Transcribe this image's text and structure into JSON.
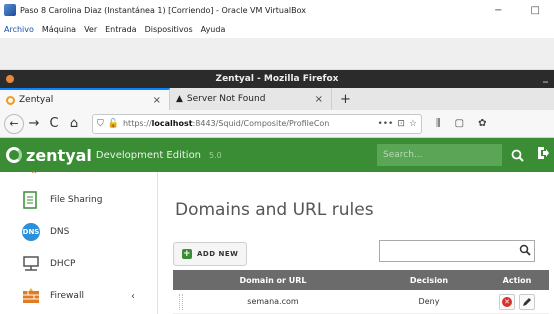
{
  "vbox": {
    "title": "Paso 8 Carolina Diaz (Instantánea 1) [Corriendo] - Oracle VM VirtualBox",
    "minimize": "−",
    "maximize": "□",
    "menu": [
      "Archivo",
      "Máquina",
      "Ver",
      "Entrada",
      "Dispositivos",
      "Ayuda"
    ]
  },
  "firefox": {
    "window_title": "Zentyal - Mozilla Firefox",
    "window_min": "_",
    "tabs": [
      {
        "label": "Zentyal",
        "close": "×"
      },
      {
        "label": "Server Not Found",
        "close": "×"
      }
    ],
    "new_tab": "+",
    "nav": {
      "back": "←",
      "forward": "→",
      "reload": "C",
      "home": "⌂"
    },
    "url": {
      "prefix": "https://",
      "host": "localhost",
      "rest": ":8443/Squid/Composite/ProfileCon",
      "more": "•••"
    }
  },
  "zentyal": {
    "logo": "zentyal",
    "edition": "Development Edition",
    "version": "5.0",
    "search_placeholder": "Search...",
    "search_icon": "search-icon",
    "logout_icon": "logout-icon",
    "colors": {
      "header": "#3a8d35",
      "danger": "#d9312b"
    }
  },
  "sidebar": {
    "items": [
      {
        "label": "File Sharing",
        "icon": "file-sharing-icon"
      },
      {
        "label": "DNS",
        "icon": "dns-icon",
        "icon_text": "DNS"
      },
      {
        "label": "DHCP",
        "icon": "dhcp-icon"
      },
      {
        "label": "Firewall",
        "icon": "firewall-icon",
        "chevron": "‹"
      }
    ]
  },
  "main": {
    "title": "Domains and URL rules",
    "add_new": "ADD NEW",
    "filter_value": "",
    "table": {
      "headers": [
        "Domain or URL",
        "Decision",
        "Action"
      ],
      "rows": [
        {
          "domain": "semana.com",
          "decision": "Deny"
        }
      ]
    }
  }
}
